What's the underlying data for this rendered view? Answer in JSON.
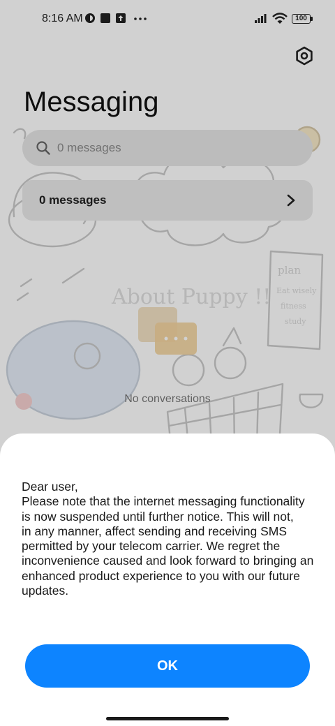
{
  "status_bar": {
    "time": "8:16 AM",
    "battery": "100",
    "icons": [
      "vpn-key-icon",
      "square-notification-icon",
      "upload-notification-icon",
      "more-dots-icon",
      "signal-icon",
      "wifi-icon",
      "battery-icon"
    ]
  },
  "header": {
    "title": "Messaging",
    "settings_icon": "settings-hexagon-icon"
  },
  "search": {
    "placeholder": "0 messages",
    "icon": "search-icon"
  },
  "category": {
    "label": "0 messages",
    "icon": "chevron-right-icon"
  },
  "empty_state": {
    "text": "No conversations"
  },
  "dialog": {
    "lines": [
      "Dear user,",
      "Please note that the internet messaging functionality",
      "is now suspended until further notice. This will not,",
      "in any manner, affect sending and receiving SMS",
      "permitted by your telecom carrier. We regret the",
      "inconvenience caused and look forward to bringing an",
      "enhanced product experience to you with our future",
      "updates."
    ],
    "ok_label": "OK"
  },
  "colors": {
    "accent": "#0d84ff",
    "search_bg": "#e6e6e6",
    "scrim": "rgba(0,0,0,0.18)"
  }
}
